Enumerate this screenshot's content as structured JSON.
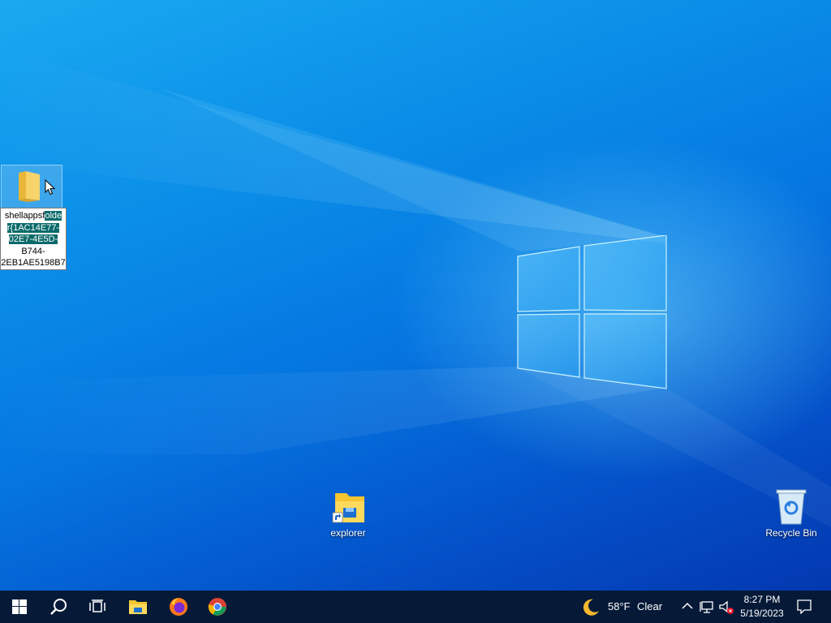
{
  "desktop": {
    "selected_icon": {
      "label_lines": [
        {
          "pre": "shellappsf",
          "hl": "olde"
        },
        {
          "pre": "",
          "hl": "r{1AC14E77-"
        },
        {
          "pre": "",
          "hl": "02E7-4E5D-"
        },
        {
          "pre": "B744-",
          "hl": ""
        },
        {
          "pre": "2EB1AE5198B7",
          "hl": ""
        }
      ]
    },
    "explorer_label": "explorer",
    "recycle_label": "Recycle Bin"
  },
  "taskbar": {
    "weather_temp": "58°F",
    "weather_cond": "Clear",
    "clock_time": "8:27 PM",
    "clock_date": "5/19/2023"
  },
  "icons": [
    "start-icon",
    "search-icon",
    "task-view-icon",
    "file-explorer-icon",
    "firefox-icon",
    "chrome-icon",
    "moon-icon",
    "chevron-up-icon",
    "network-icon",
    "volume-muted-icon",
    "notification-icon"
  ]
}
